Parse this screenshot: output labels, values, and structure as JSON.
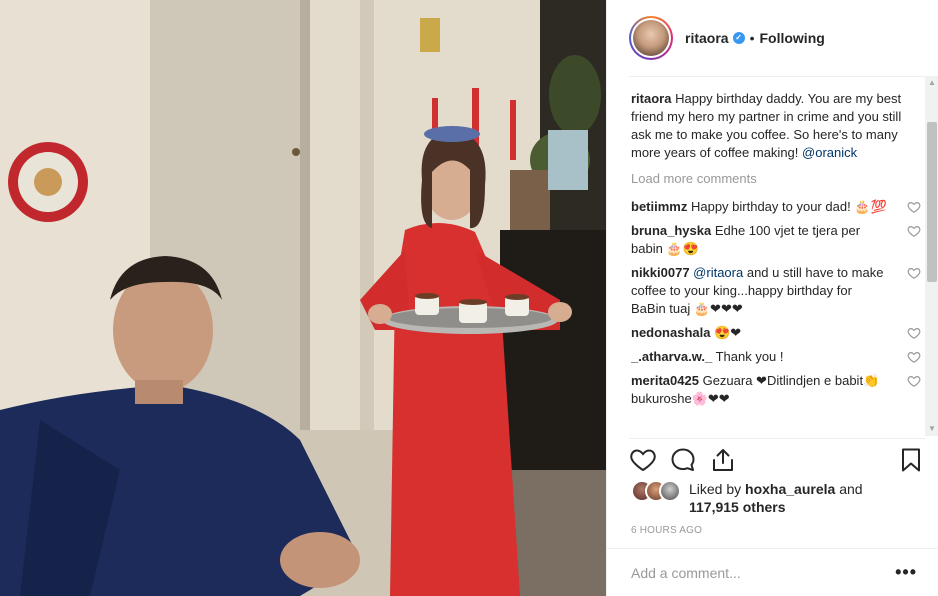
{
  "post": {
    "username": "ritaora",
    "follow_status": "Following",
    "separator": "•",
    "caption_user": "ritaora",
    "caption_text": "Happy birthday daddy. You are my best friend my hero my partner in crime and you still ask me to make you coffee. So here's to many more years of coffee making!",
    "caption_mention": "@oranick",
    "load_more": "Load more comments",
    "comments": [
      {
        "user": "betiimmz",
        "text": "Happy birthday to your dad! 🎂💯",
        "mention": ""
      },
      {
        "user": "bruna_hyska",
        "text": "Edhe 100 vjet te tjera per babin 🎂😍",
        "mention": ""
      },
      {
        "user": "nikki0077",
        "mention": "@ritaora",
        "text": "and u still have to make coffee to your king...happy birthday for BaBin tuaj 🎂❤❤❤"
      },
      {
        "user": "nedonashala",
        "text": "😍❤",
        "mention": ""
      },
      {
        "user": "_.atharva.w._",
        "text": "Thank you !",
        "mention": ""
      },
      {
        "user": "merita0425",
        "text": "Gezuara ❤Ditlindjen e babit👏bukuroshe🌸❤❤",
        "mention": ""
      }
    ],
    "liked_by_prefix": "Liked by",
    "liked_by_user": "hoxha_aurela",
    "liked_by_and": "and",
    "likes_count": "117,915 others",
    "timestamp": "6 HOURS AGO",
    "add_comment_placeholder": "Add a comment...",
    "more_options": "•••"
  },
  "icons": {
    "verified": "verified-badge-icon",
    "like": "heart-icon",
    "comment": "comment-icon",
    "share": "share-icon",
    "save": "bookmark-icon",
    "comment_like": "heart-small-icon",
    "scroll_up": "▲",
    "scroll_down": "▼"
  },
  "colors": {
    "verified": "#3897f0",
    "mention": "#003569",
    "muted": "#999999",
    "text": "#262626"
  }
}
